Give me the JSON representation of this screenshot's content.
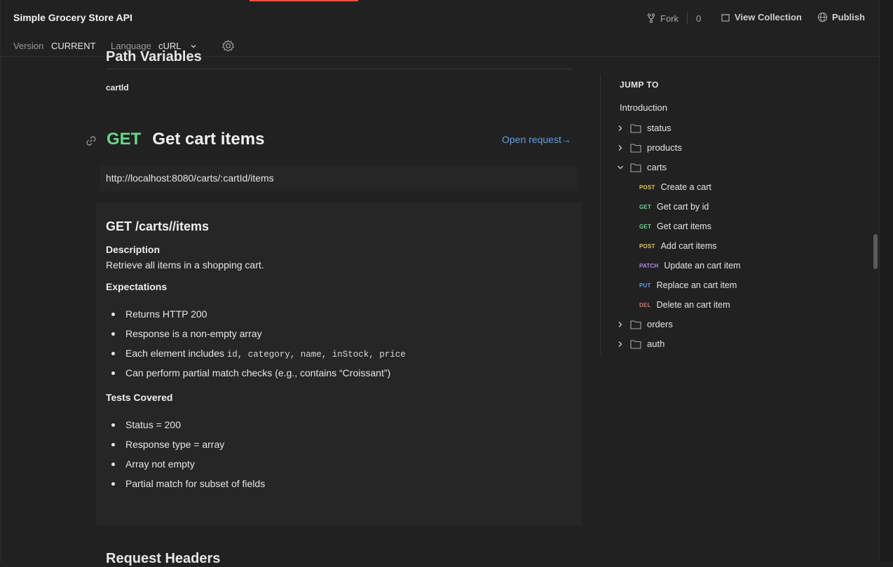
{
  "app": {
    "title": "Simple Grocery Store API",
    "fork_label": "Fork",
    "fork_count": "0",
    "view_collection": "View Collection",
    "publish": "Publish"
  },
  "meta": {
    "version_label": "Version",
    "version_value": "CURRENT",
    "language_label": "Language",
    "language_value": "cURL"
  },
  "doc": {
    "prev_section_title": "Path Variables",
    "path_param": "cartId",
    "request": {
      "method": "GET",
      "name": "Get cart items",
      "open_request": "Open request→",
      "url": "http://localhost:8080/carts/:cartId/items"
    },
    "description": {
      "heading": "GET /carts//items",
      "desc_label": "Description",
      "desc_text": "Retrieve all items in a shopping cart.",
      "expectations_label": "Expectations",
      "expectations": [
        "Returns HTTP 200",
        "Response is a non-empty array",
        "Each element includes",
        "Can perform partial match checks (e.g., contains “Croissant”)"
      ],
      "fields_code": "id, category, name, inStock, price",
      "tests_label": "Tests Covered",
      "tests": [
        "Status = 200",
        "Response type = array",
        "Array not empty",
        "Partial match for subset of fields"
      ]
    },
    "next_section_title": "Request Headers"
  },
  "jump_to": {
    "title": "JUMP TO",
    "intro": "Introduction",
    "folders": [
      "status",
      "products",
      "carts",
      "orders",
      "auth"
    ],
    "cart_requests": [
      {
        "method": "POST",
        "name": "Create a cart"
      },
      {
        "method": "GET",
        "name": "Get cart by id"
      },
      {
        "method": "GET",
        "name": "Get cart items"
      },
      {
        "method": "POST",
        "name": "Add cart items"
      },
      {
        "method": "PATCH",
        "name": "Update an cart item"
      },
      {
        "method": "PUT",
        "name": "Replace an cart item"
      },
      {
        "method": "DEL",
        "name": "Delete an cart item"
      }
    ]
  }
}
